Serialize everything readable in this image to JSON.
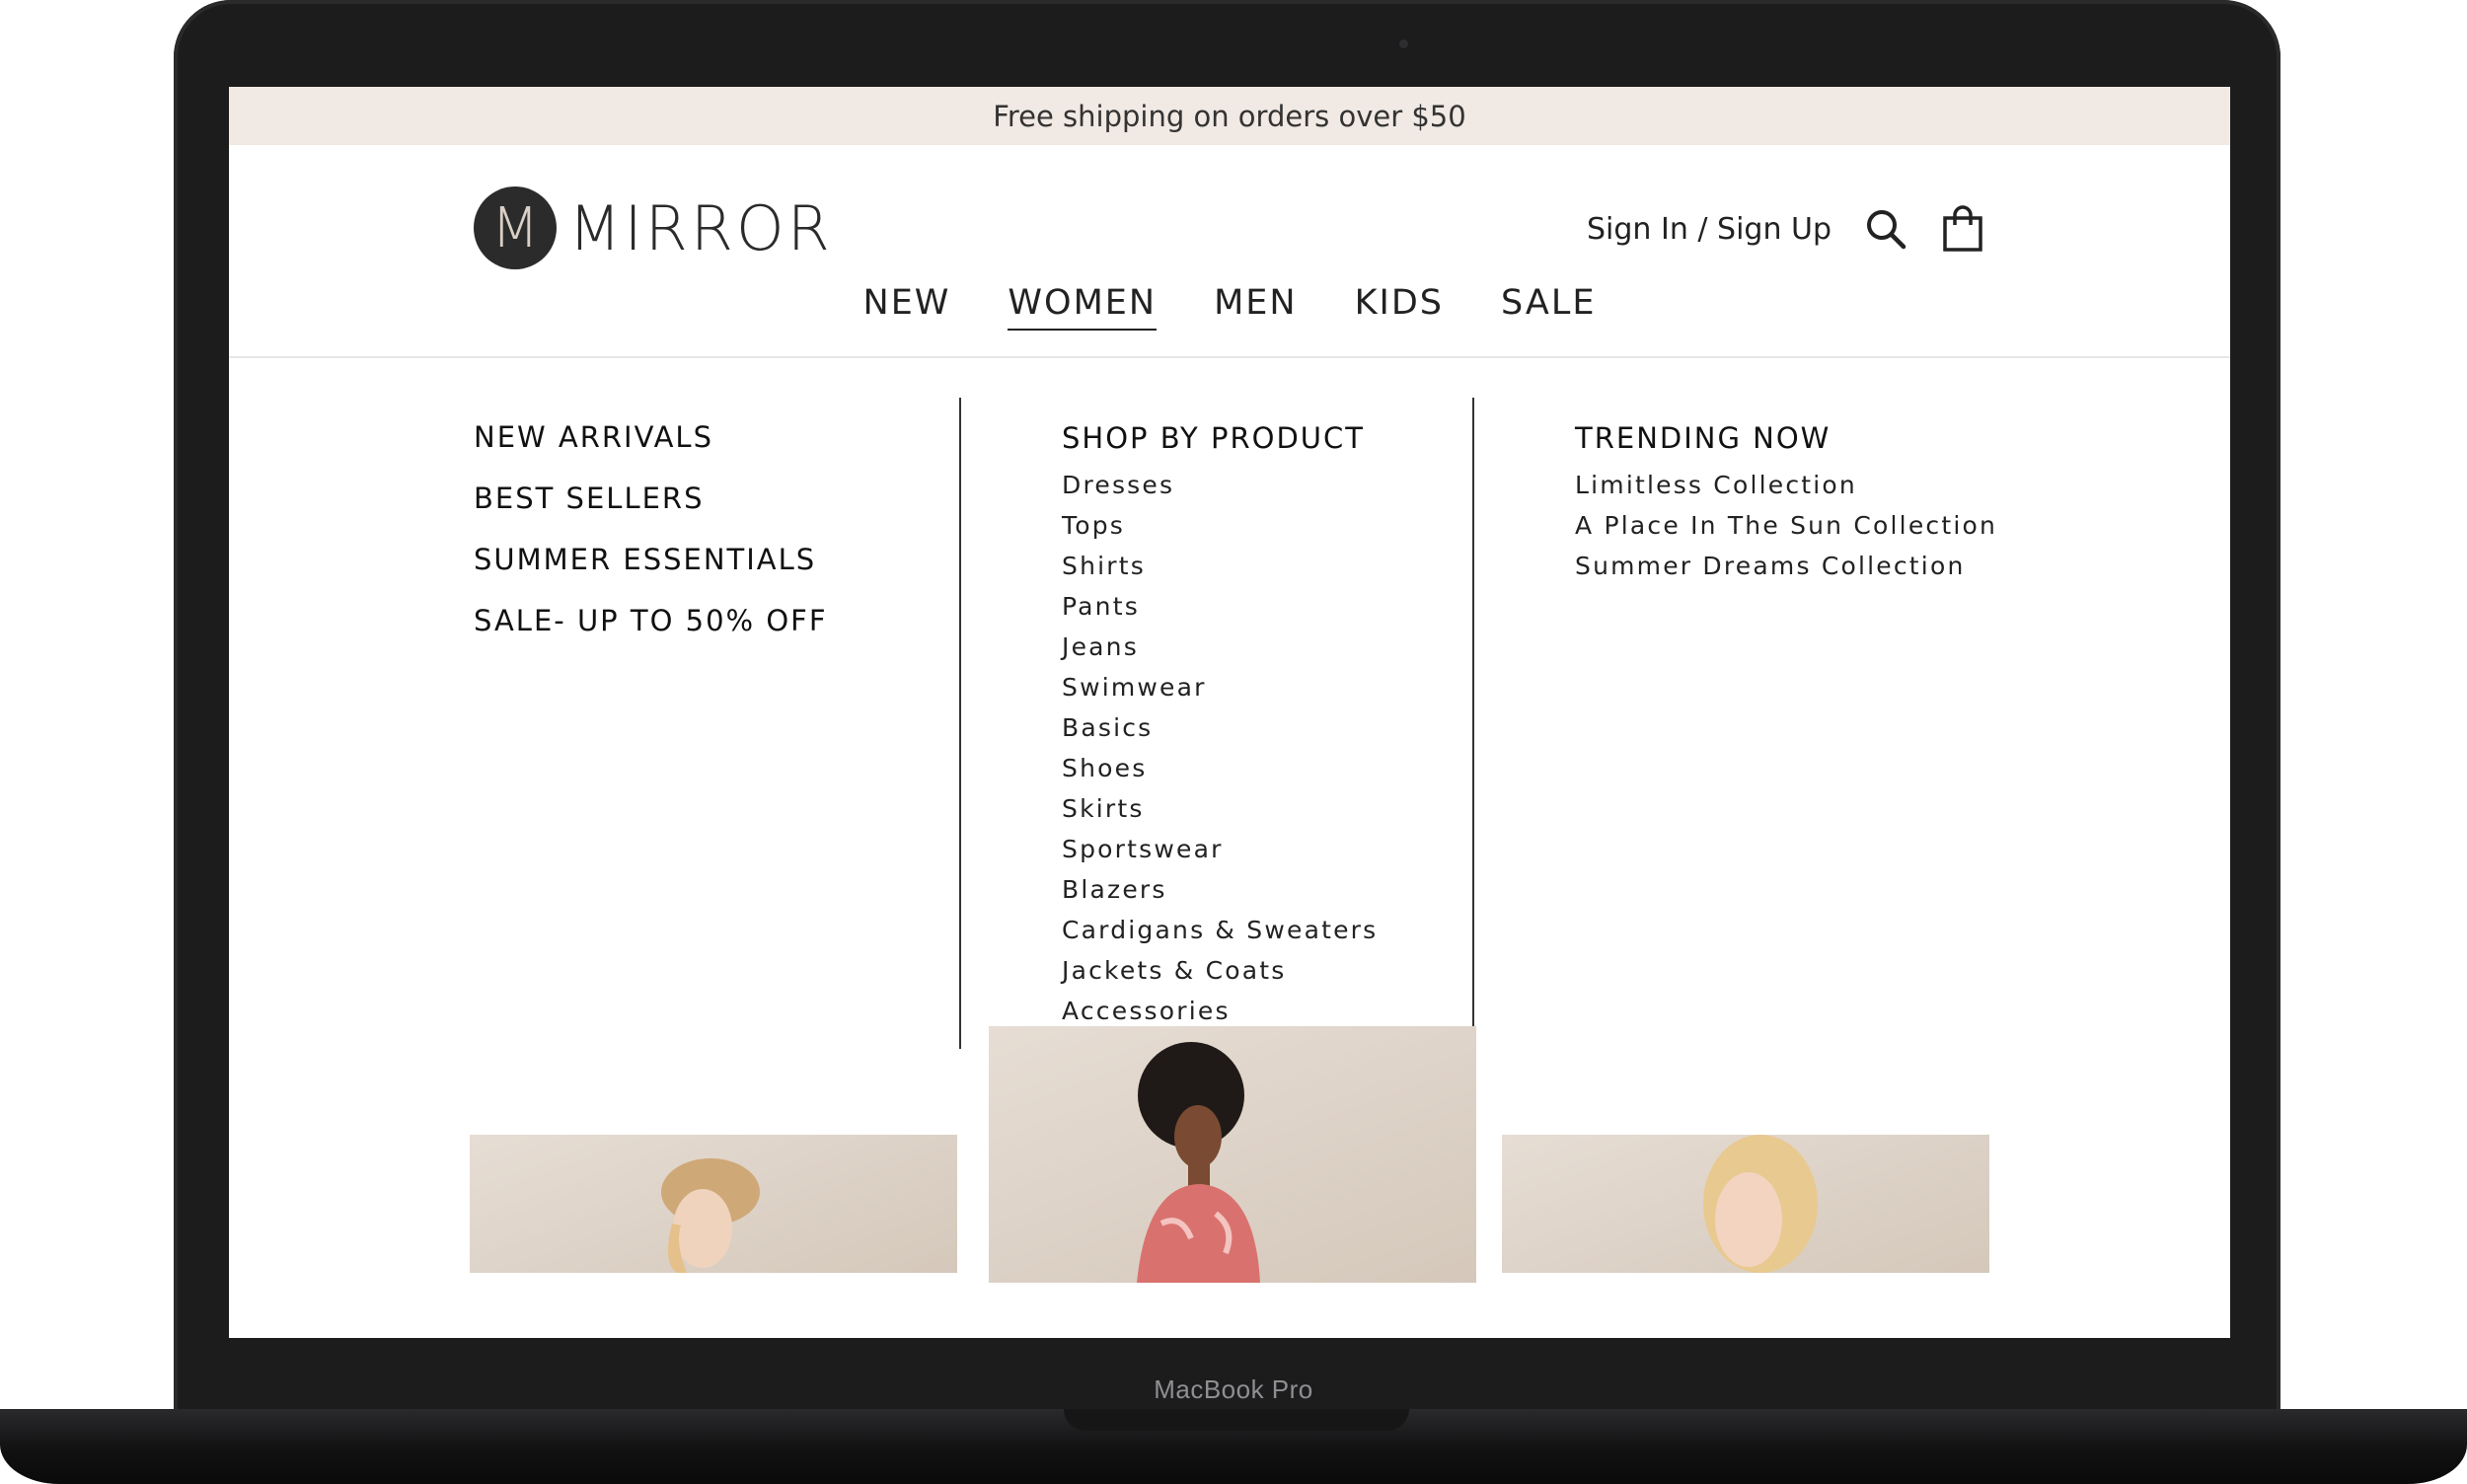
{
  "device": {
    "model_label": "MacBook Pro"
  },
  "promo": {
    "text": "Free shipping on orders over $50"
  },
  "header": {
    "logo_mark": "M",
    "logo_text": "MIRROR",
    "signin_label": "Sign In / Sign Up",
    "search_icon": "search-icon",
    "cart_icon": "shopping-bag-icon"
  },
  "nav": {
    "items": [
      {
        "label": "NEW",
        "active": false
      },
      {
        "label": "WOMEN",
        "active": true
      },
      {
        "label": "MEN",
        "active": false
      },
      {
        "label": "KIDS",
        "active": false
      },
      {
        "label": "SALE",
        "active": false
      }
    ]
  },
  "mega": {
    "featured": [
      "NEW ARRIVALS",
      "BEST SELLERS",
      "SUMMER ESSENTIALS",
      "SALE- UP TO 50% OFF"
    ],
    "by_product": {
      "heading": "SHOP BY PRODUCT",
      "items": [
        "Dresses",
        "Tops",
        "Shirts",
        "Pants",
        "Jeans",
        "Swimwear",
        "Basics",
        "Shoes",
        "Skirts",
        "Sportswear",
        "Blazers",
        "Cardigans & Sweaters",
        "Jackets & Coats",
        "Accessories"
      ]
    },
    "trending": {
      "heading": "TRENDING NOW",
      "items": [
        "Limitless Collection",
        "A Place In The Sun Collection",
        "Summer Dreams Collection"
      ]
    }
  },
  "colors": {
    "promo_bg": "#f1e9e3",
    "text": "#222222",
    "accent_logo": "#2b2b2b"
  }
}
